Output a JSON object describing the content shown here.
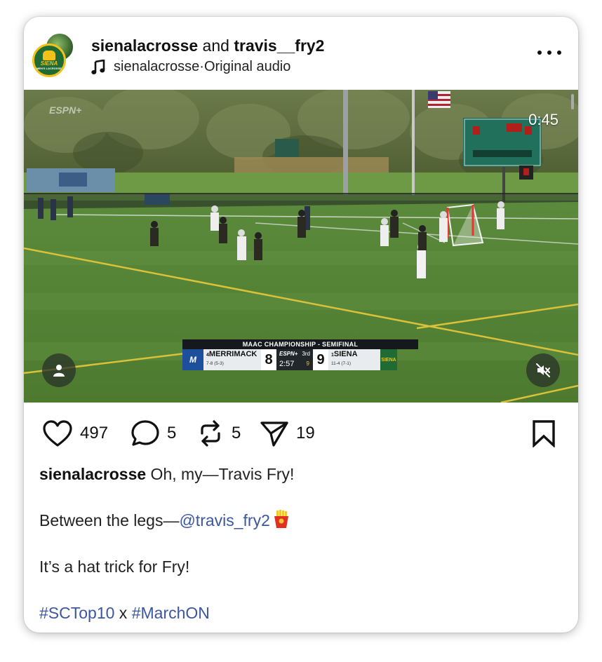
{
  "header": {
    "user1": "sienalacrosse",
    "and_text": " and ",
    "user2": "travis__fry2",
    "audio_user": "sienalacrosse",
    "audio_sep": " · ",
    "audio_label": "Original audio",
    "avatar_text": "SIENA",
    "avatar_sub": "MEN'S LACROSSE"
  },
  "video": {
    "timer": "0:45",
    "network_watermark": "ESPN+",
    "scorebug": {
      "title": "MAAC CHAMPIONSHIP - SEMIFINAL",
      "away": {
        "seed": "4",
        "name": "MERRIMACK",
        "record": "7-8 (5-3)",
        "score": "8",
        "logo": "M"
      },
      "home": {
        "seed": "1",
        "name": "SIENA",
        "record": "11-4 (7-1)",
        "score": "9",
        "logo": "SIENA"
      },
      "network": "ESPN+",
      "period": "3rd",
      "clock": "2:57",
      "shots": "9"
    },
    "scoreboard_label": "SIENA"
  },
  "actions": {
    "likes": "497",
    "comments": "5",
    "reposts": "5",
    "shares": "19"
  },
  "caption": {
    "user": "sienalacrosse",
    "line1": " Oh, my—Travis Fry!",
    "line2_prefix": "Between the legs—",
    "mention": "@travis_fry2",
    "line3": "It’s a hat trick for Fry!",
    "tag1": "#SCTop10",
    "sep": " x ",
    "tag2": "#MarchON"
  },
  "colors": {
    "link": "#3b57a0",
    "siena_green": "#1f6b33",
    "siena_gold": "#f2c21a",
    "merrimack_blue": "#1d4f9c"
  }
}
